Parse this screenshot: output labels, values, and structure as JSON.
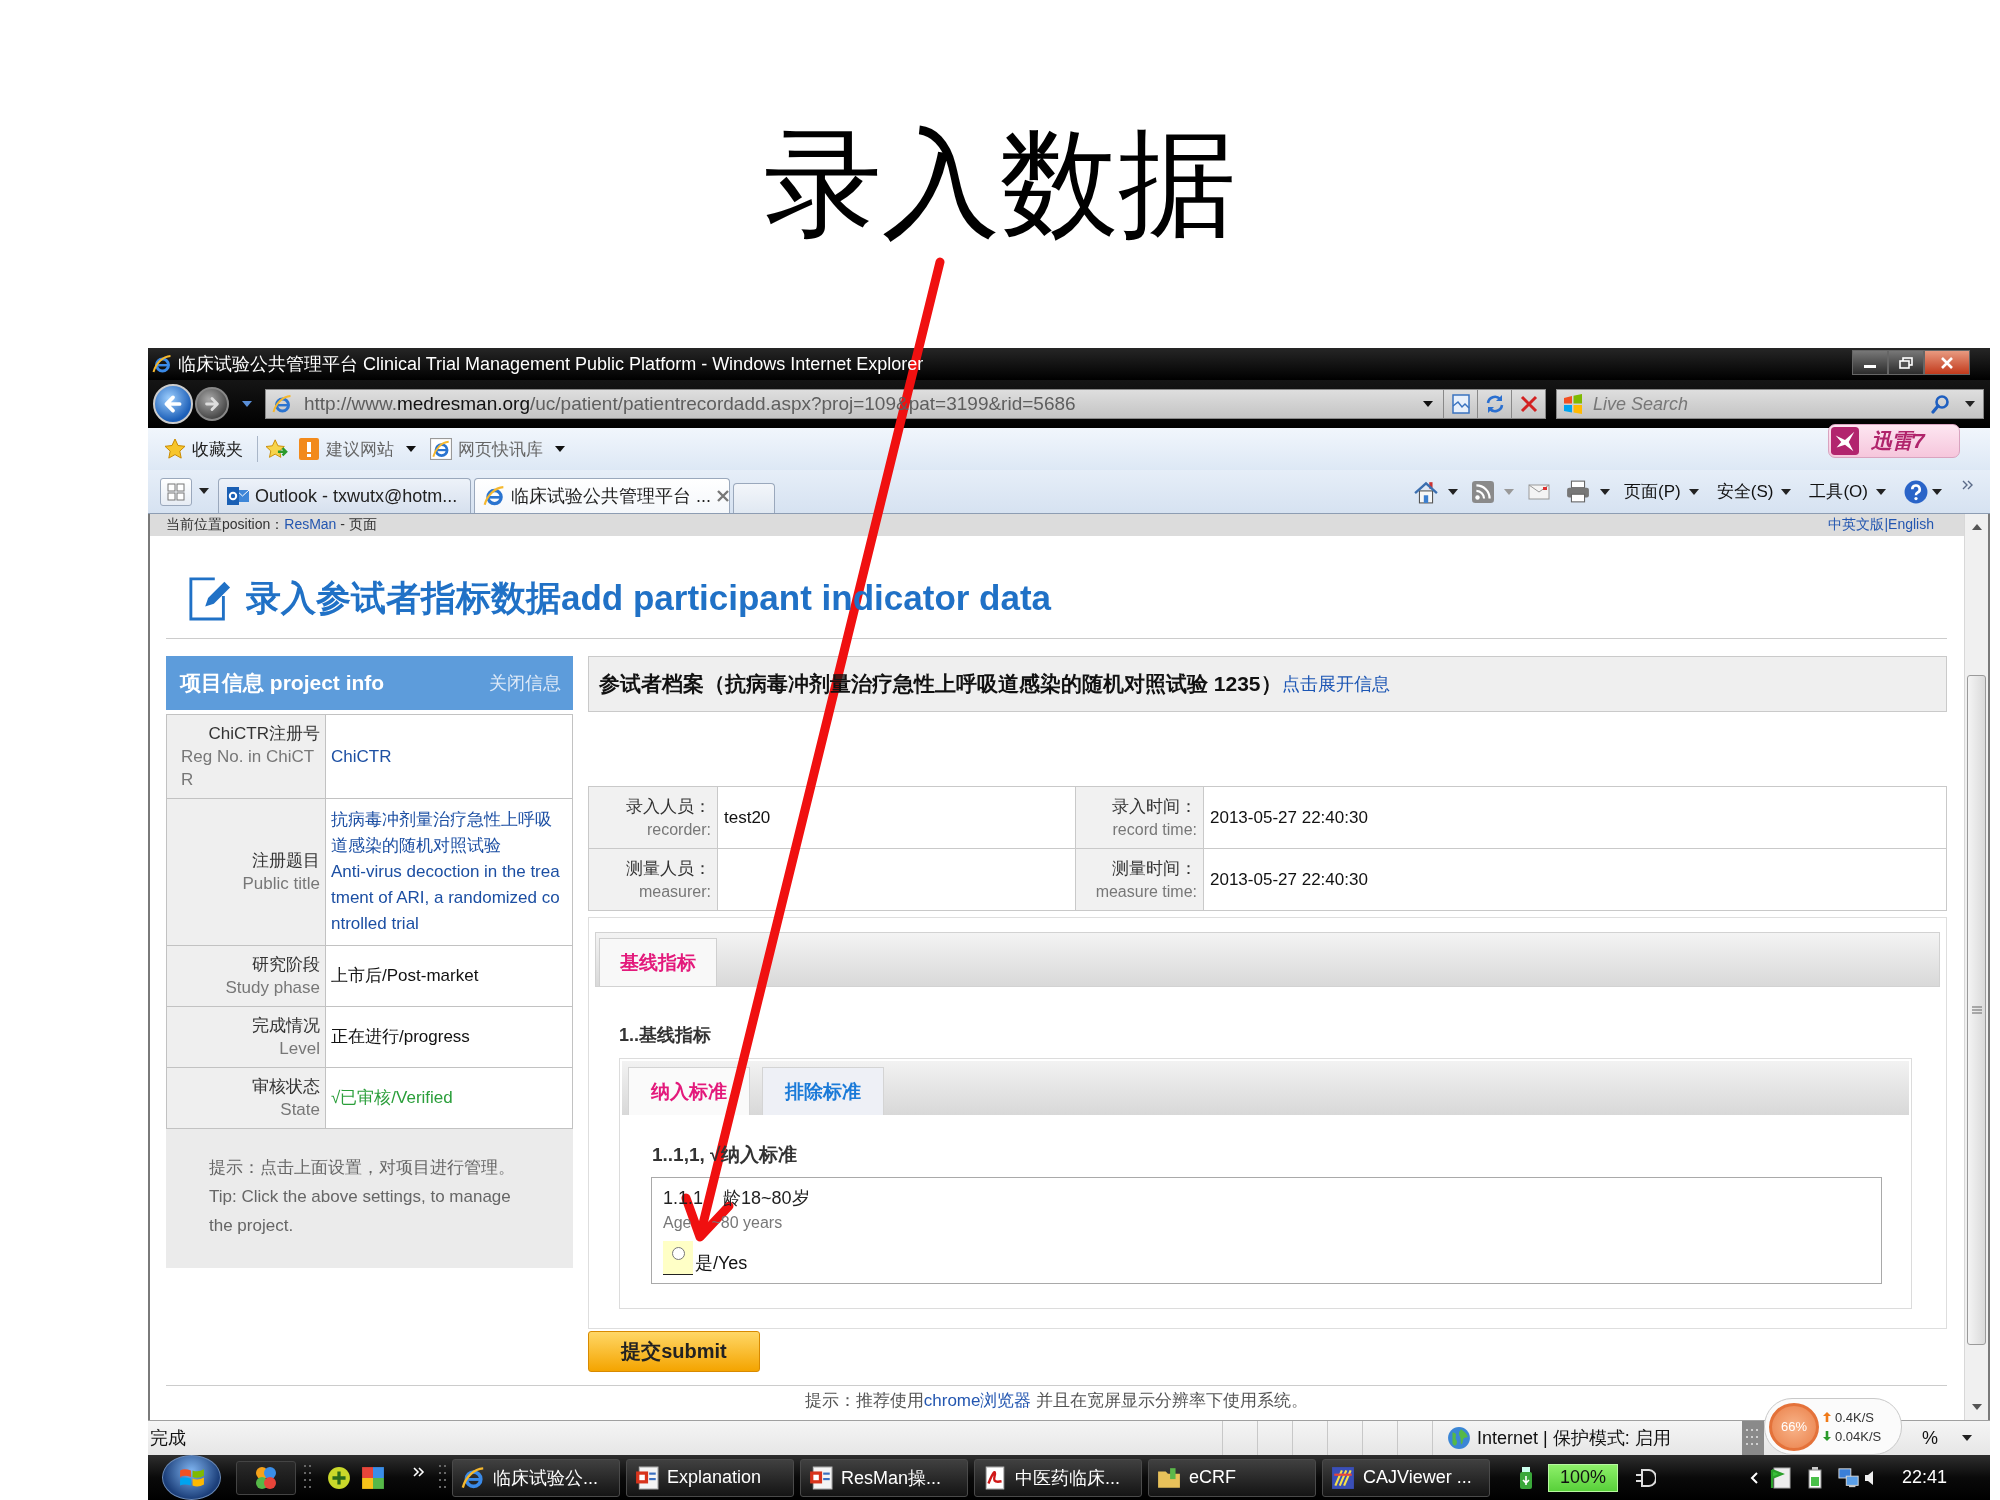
{
  "slide": {
    "title": "录入数据"
  },
  "window": {
    "title": "临床试验公共管理平台 Clinical Trial Management Public Platform - Windows Internet Explorer"
  },
  "address_bar": {
    "url_start": "http://www.",
    "url_domain": "medresman.org",
    "url_end": "/uc/patient/patientrecordadd.aspx?proj=109&pat=3199&rid=5686",
    "search_placeholder": "Live Search"
  },
  "favorites_bar": {
    "items": [
      {
        "label": "收藏夹",
        "kind": "favorites"
      },
      {
        "label": "建议网站",
        "kind": "suggested"
      },
      {
        "label": "网页快讯库",
        "kind": "slices"
      }
    ],
    "addon_button": "迅雷7"
  },
  "tabs": [
    {
      "label": "Outlook - txwutx@hotm...",
      "kind": "outlook",
      "selected": false
    },
    {
      "label": "临床试验公共管理平台 ...",
      "kind": "ie",
      "selected": true
    }
  ],
  "command_menus": [
    "页面(P)",
    "安全(S)",
    "工具(O)"
  ],
  "page": {
    "breadcrumb": {
      "label": "当前位置position：",
      "link": "ResMan",
      "current": " - 页面"
    },
    "language_link": "中英文版|English",
    "heading": "录入参试者指标数据add participant indicator data",
    "project_info": {
      "title": "项目信息 project info",
      "close_link": "关闭信息",
      "rows": [
        {
          "label": "ChiCTR注册号",
          "label_en": "Reg No. in ChiCTR",
          "kind": "link",
          "values": [
            "ChiCTR"
          ]
        },
        {
          "label": "注册题目",
          "label_en": "Public title",
          "kind": "link",
          "values": [
            "抗病毒冲剂量治疗急性上呼吸道感染的随机对照试验",
            "Anti-virus decoction in the treatment of ARI, a randomized controlled trial"
          ]
        },
        {
          "label": "研究阶段",
          "label_en": "Study phase",
          "kind": "text",
          "values": [
            "上市后/Post-market"
          ]
        },
        {
          "label": "完成情况",
          "label_en": "Level",
          "kind": "text",
          "values": [
            "正在进行/progress"
          ]
        },
        {
          "label": "审核状态",
          "label_en": "State",
          "kind": "status",
          "values": [
            "√已审核/Verified"
          ]
        }
      ],
      "tip": [
        "提示：点击上面设置，对项目进行管理。",
        "Tip: Click the above settings, to manage the project."
      ]
    },
    "participant": {
      "title": "参试者档案（抗病毒冲剂量治疗急性上呼吸道感染的随机对照试验 1235）",
      "expand_link": "点击展开信息"
    },
    "record_fields": [
      [
        {
          "label": "录入人员：",
          "label_en": "recorder:",
          "value": "test20"
        },
        {
          "label": "录入时间：",
          "label_en": "record time:",
          "value": "2013-05-27 22:40:30"
        }
      ],
      [
        {
          "label": "测量人员：",
          "label_en": "measurer:"
        },
        {
          "label": "测量时间：",
          "label_en": "measure time:",
          "value": "2013-05-27 22:40:30"
        }
      ]
    ],
    "section_tabs": [
      {
        "label": "基线指标",
        "selected": true
      }
    ],
    "section_title": "1..基线指标",
    "criteria_tabs": [
      {
        "label": "纳入标准",
        "selected": true
      },
      {
        "label": "排除标准",
        "selected": false
      }
    ],
    "group_title": "1..1,1, √纳入标准",
    "question": {
      "title": [
        "1.1.1",
        "龄18~80岁"
      ],
      "subtitle": [
        "Age",
        "~80 years"
      ],
      "options": [
        {
          "label": "是/Yes",
          "selected": false
        }
      ]
    },
    "submit": "提交submit",
    "footer": {
      "text_before": "提示：推荐使用",
      "link": "chrome浏览器",
      "text_after": " 并且在宽屏显示分辨率下使用系统。"
    }
  },
  "status_bar": {
    "text": "完成",
    "zone": "Internet | 保护模式: 启用",
    "zoom": "%",
    "monitor": {
      "load": "66%",
      "upload": "0.4K/S",
      "download": "0.04K/S"
    }
  },
  "taskbar": {
    "tasks": [
      {
        "label": "临床试验公...",
        "kind": "ie"
      },
      {
        "label": "Explanation",
        "kind": "slides"
      },
      {
        "label": "ResMan操...",
        "kind": "slides"
      },
      {
        "label": "中医药临床...",
        "kind": "pdf"
      },
      {
        "label": "eCRF",
        "kind": "folder"
      },
      {
        "label": "CAJViewer ...",
        "kind": "viewer"
      }
    ],
    "battery": "100%",
    "clock": "22:41"
  }
}
